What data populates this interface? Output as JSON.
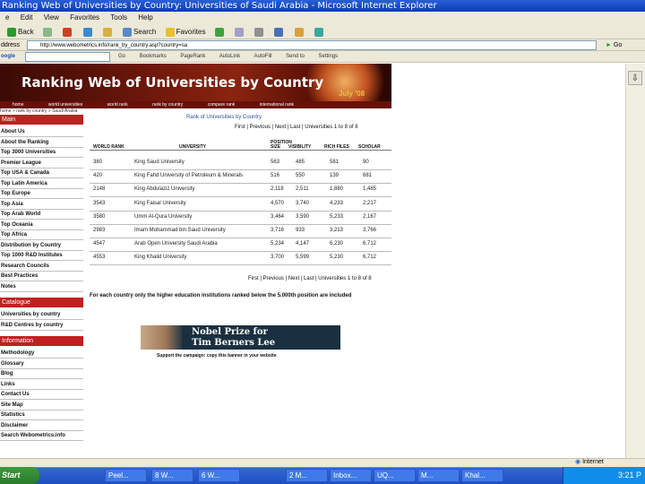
{
  "window": {
    "title": "Ranking Web of Universities by Country: Universities of Saudi Arabia - Microsoft Internet Explorer"
  },
  "menubar": {
    "items": [
      "e",
      "Edit",
      "View",
      "Favorites",
      "Tools",
      "Help"
    ]
  },
  "toolbar": {
    "back": "Back",
    "search": "Search",
    "favorites": "Favorites"
  },
  "addressbar": {
    "label": "ddress",
    "url": "http://www.webometrics.info/rank_by_country.asp?country=sa",
    "go": "Go"
  },
  "googlebar": {
    "label": "oogle",
    "items": [
      "Go",
      "Bookmarks",
      "PageRank",
      "AutoLink",
      "AutoFill",
      "Send to",
      "Settings"
    ]
  },
  "banner": {
    "title": "Ranking Web of Universities by Country",
    "date": "July '08"
  },
  "navstrip": {
    "items": [
      "home",
      "world universities",
      "world rank",
      "rank by country",
      "compare rank",
      "international rank"
    ]
  },
  "breadcrumb": "home > rank by country > Saudi Arabia",
  "sidebar": {
    "sections": [
      {
        "title": "Main",
        "items": [
          "About Us",
          "About the Ranking",
          "Top 3000 Universities",
          "Premier League",
          "Top USA & Canada",
          "Top Latin America",
          "Top Europe",
          "Top Asia",
          "Top Arab World",
          "Top Oceania",
          "Top Africa",
          "Distribution by Country",
          "Top 1000 R&D Institutes",
          "Research Councils",
          "Best Practices",
          "Notes"
        ]
      },
      {
        "title": "Catalogue",
        "items": [
          "Universities by country",
          "R&D Centres by country"
        ]
      },
      {
        "title": "Information",
        "items": [
          "Methodology",
          "Glossary",
          "Blog",
          "Links",
          "Contact Us",
          "Site Map",
          "Statistics",
          "Disclaimer",
          "Search Webometrics.info"
        ]
      }
    ]
  },
  "table": {
    "title": "Rank of Universities by Country",
    "pager_top": "First | Previous | Next | Last | Universities 1 to 8 of 8",
    "pager_bottom": "First | Previous | Next | Last | Universities 1 to 8 of 8",
    "position_header": "POSITION",
    "columns": [
      "WORLD RANK",
      "UNIVERSITY",
      "SIZE",
      "VISIBILITY",
      "RICH FILES",
      "SCHOLAR"
    ],
    "rows": [
      {
        "rank": "380",
        "name": "King Saud University",
        "size": "563",
        "visibility": "485",
        "rich": "581",
        "scholar": "90"
      },
      {
        "rank": "420",
        "name": "King Fahd University of Petroleum & Minerals",
        "size": "516",
        "visibility": "550",
        "rich": "139",
        "scholar": "681"
      },
      {
        "rank": "2148",
        "name": "King Abdulaziz University",
        "size": "2,118",
        "visibility": "2,511",
        "rich": "1,880",
        "scholar": "1,485"
      },
      {
        "rank": "3543",
        "name": "King Faisal University",
        "size": "4,570",
        "visibility": "3,740",
        "rich": "4,233",
        "scholar": "2,217"
      },
      {
        "rank": "3580",
        "name": "Umm Al-Qura University",
        "size": "3,464",
        "visibility": "3,590",
        "rich": "5,233",
        "scholar": "2,167"
      },
      {
        "rank": "2983",
        "name": "Imam Mohammad bin Saud University",
        "size": "3,716",
        "visibility": "933",
        "rich": "3,213",
        "scholar": "3,766"
      },
      {
        "rank": "4547",
        "name": "Arab Open University Saudi Arabia",
        "size": "5,234",
        "visibility": "4,147",
        "rich": "6,230",
        "scholar": "6,712"
      },
      {
        "rank": "4553",
        "name": "King Khalid University",
        "size": "3,700",
        "visibility": "5,599",
        "rich": "5,230",
        "scholar": "6,712"
      }
    ],
    "footnote": "For each country only the higher education institutions ranked below the 5.000th position are included"
  },
  "promo": {
    "line1": "Nobel Prize for",
    "line2": "Tim Berners Lee",
    "caption": "Support the campaign: copy this banner in your website"
  },
  "statusbar": {
    "zone": "Internet"
  },
  "taskbar": {
    "start": "Start",
    "tasks": [
      "Peel...",
      "8 W...",
      "6 W...",
      "2 M...",
      "Inbox...",
      "UQ...",
      "M...",
      "Khal..."
    ],
    "clock": "3:21 P"
  },
  "colors": {
    "accent": "#c02020",
    "banner": "#6a160a",
    "taskbar": "#1e4fc0"
  }
}
